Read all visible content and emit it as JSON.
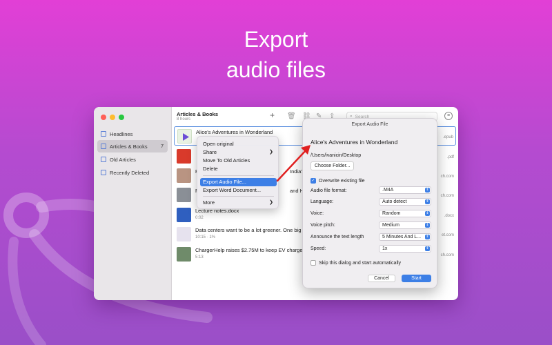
{
  "headline": {
    "line1": "Export",
    "line2": "audio files"
  },
  "colors": {
    "accent": "#3d7fe6",
    "arrow": "#e02020",
    "bg_top": "#e23fd6",
    "bg_bottom": "#9a4fc8"
  },
  "sidebar": {
    "items": [
      {
        "label": "Headlines",
        "icon": "headlines-icon",
        "count": ""
      },
      {
        "label": "Articles & Books",
        "icon": "articles-icon",
        "count": "7"
      },
      {
        "label": "Old Articles",
        "icon": "archive-icon",
        "count": ""
      },
      {
        "label": "Recently Deleted",
        "icon": "trash-icon",
        "count": ""
      }
    ]
  },
  "header": {
    "title": "Articles & Books",
    "subtitle": "8 hours"
  },
  "search": {
    "placeholder": "Search"
  },
  "list": [
    {
      "title": "Alice's Adventures in Wonderland",
      "meta": "",
      "right": ".epub"
    },
    {
      "title": "",
      "meta": "",
      "right": ".pdf"
    },
    {
      "title": "F",
      "meta": "",
      "right": "ch.com",
      "title_tail": "India?"
    },
    {
      "title": "F",
      "meta": "",
      "right": "ch.com",
      "title_tail": "and How It"
    },
    {
      "title": "Lecture notes.docx",
      "meta": "0:02",
      "right": ".docx"
    },
    {
      "title": "Data centers want to be a lot greener. One big",
      "meta": "10:15  ·  1%",
      "right": "et.com"
    },
    {
      "title": "ChargerHelp raises $2.75M to keep EV charge",
      "meta": "5:13",
      "right": "ch.com"
    }
  ],
  "context_menu": {
    "items": [
      "Open original",
      "Share",
      "Move To Old Articles",
      "Delete",
      "Export Audio File...",
      "Export Word Document...",
      "More"
    ]
  },
  "dialog": {
    "title": "Export Audio File",
    "heading": "Alice's Adventures in Wonderland",
    "path": "/Users/ivanicin/Desktop",
    "choose_folder": "Choose Folder...",
    "overwrite": "Overwrite existing file",
    "fields": [
      {
        "label": "Audio file format:",
        "value": ".M4A"
      },
      {
        "label": "Language:",
        "value": "Auto detect"
      },
      {
        "label": "Voice:",
        "value": "Random"
      },
      {
        "label": "Voice pitch:",
        "value": "Medium"
      },
      {
        "label": "Announce the text length",
        "value": "5 Minutes And L..."
      },
      {
        "label": "Speed:",
        "value": "1x"
      }
    ],
    "skip": "Skip this dialog and start automatically",
    "cancel": "Cancel",
    "start": "Start"
  }
}
